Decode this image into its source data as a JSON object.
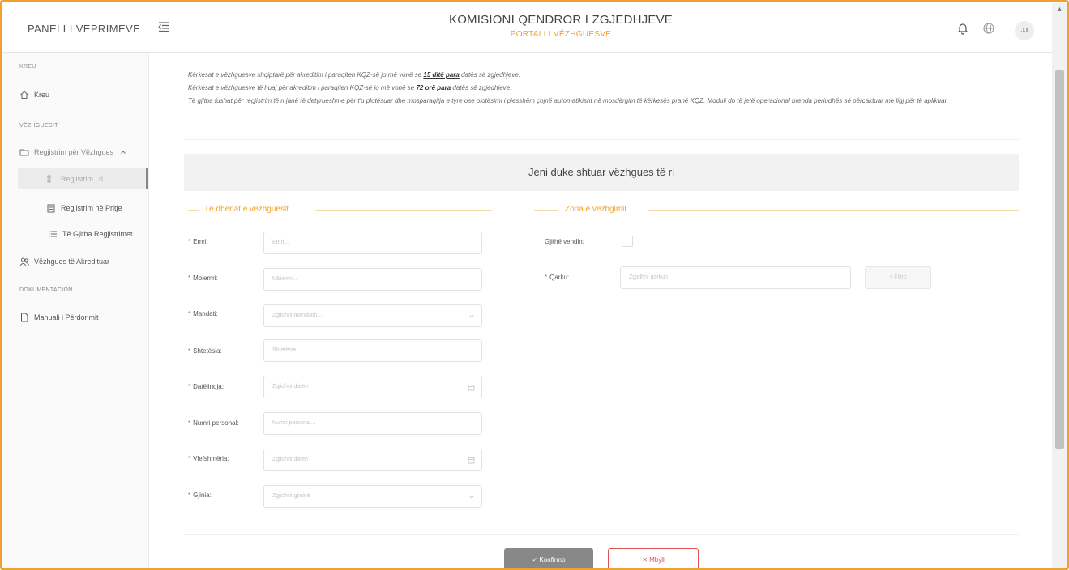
{
  "header": {
    "brand": "PANELI I VEPRIMEVE",
    "title": "KOMISIONI QENDROR I ZGJEDHJEVE",
    "subtitle": "PORTALI I VËZHGUESVE",
    "avatar_initials": "JJ"
  },
  "sidebar": {
    "section_kreu": "KREU",
    "kreu": "Kreu",
    "section_vezhguesit": "VËZHGUESIT",
    "regjistrim_group": "Regjistrim për Vëzhgues",
    "regjistrim_ri": "Regjistrim i ri",
    "regjistrim_pritje": "Regjistrim në Pritje",
    "te_gjitha": "Të Gjitha Regjistrimet",
    "akredituar": "Vëzhgues të Akredituar",
    "section_dok": "DOKUMENTACION",
    "manuali": "Manuali i Përdorimit"
  },
  "info": {
    "line1_pre": "Kërkesat e vëzhguesve shqiptarë për akreditim i paraqiten KQZ-së jo më vonë se ",
    "line1_bold": "15 ditë para",
    "line1_post": " datës së zgjedhjeve.",
    "line2_pre": "Kërkesat e vëzhguesve të huaj për akreditim i paraqiten KQZ-së jo më vonë se ",
    "line2_bold": "72 orë para",
    "line2_post": " datës së zgjedhjeve.",
    "line3": "Të gjitha fushat për regjistrim të ri janë të detyrueshme për t'u plotësuar dhe mosparaqitja e tyre ose plotësimi i pjesshëm çojnë automatikisht në mosdërgim të kërkesës pranë KQZ. Moduli do të jetë operacional brenda periudhës së përcaktuar me ligj për të aplikuar."
  },
  "banner": "Jeni duke shtuar vëzhgues të ri",
  "form": {
    "legend_left": "Të dhënat e vëzhguesit",
    "legend_right": "Zona e vëzhgimit",
    "req": "*",
    "fields": [
      {
        "label": "Emri:",
        "placeholder": "Emri..."
      },
      {
        "label": "Mbiemri:",
        "placeholder": "Mbiemri..."
      },
      {
        "label": "Mandati:",
        "placeholder": "Zgjidhni mandatin..."
      },
      {
        "label": "Shtetësia:",
        "placeholder": "Shtetësia..."
      },
      {
        "label": "Datëlindja:",
        "placeholder": "Zgjidhni datën"
      },
      {
        "label": "Numri personal:",
        "placeholder": "Numri personal..."
      },
      {
        "label": "Vlefshmëria:",
        "placeholder": "Zgjidhni datën"
      },
      {
        "label": "Gjinia:",
        "placeholder": "Zgjidhni gjininë"
      }
    ],
    "gjithe_vendin": "Gjithë vendin:",
    "qarku_label": "Qarku:",
    "qarku_placeholder": "Zgjidhni qarkun",
    "filter_button": "+ Filtro"
  },
  "buttons": {
    "confirm": "✓  Konfirmo",
    "close": "✕  Mbyll"
  }
}
